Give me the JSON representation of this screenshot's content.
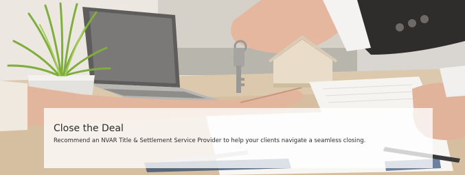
{
  "banner": {
    "title": "Close the Deal",
    "description": "Recommend an NVAR Title & Settlement Service Provider to help your clients navigate a seamless closing."
  },
  "photo": {
    "subject": "real-estate-closing-key-handover-photo",
    "icons": [
      "plant-icon",
      "laptop-icon",
      "key-icon",
      "house-model-icon",
      "pen-icon",
      "document-icon"
    ]
  },
  "colors": {
    "panel_overlay": "#ffffff",
    "text": "#2b2b2b",
    "wood_desk": "#d7c3a6",
    "plant_green": "#7fae3c"
  }
}
